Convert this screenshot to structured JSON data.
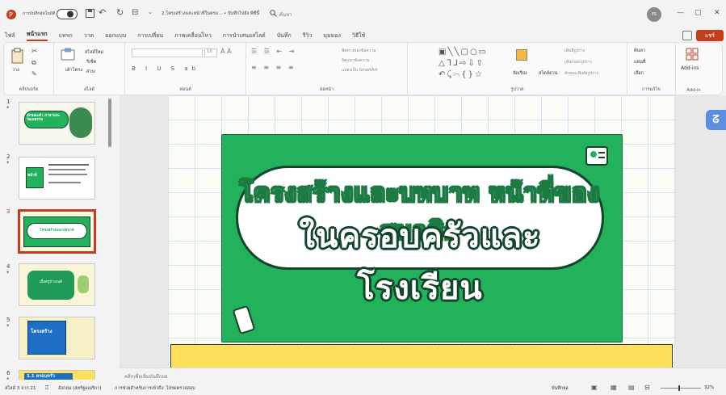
{
  "titlebar": {
    "autosave_label": "การบันทึกอัตโนมัติ",
    "doc_title": "2.โครงสร้างและหน้าที่ในครอ... • บันทึกไปยัง พีซีนี้",
    "search_placeholder": "ค้นหา",
    "user_initials": "PS",
    "minimize": "—",
    "restore": "▢",
    "close": "✕"
  },
  "ribbon_tabs": [
    "ไฟล์",
    "หน้าแรก",
    "แทรก",
    "วาด",
    "ออกแบบ",
    "การเปลี่ยน",
    "ภาพเคลื่อนไหว",
    "การนำเสนอสไลด์",
    "บันทึก",
    "รีวิว",
    "มุมมอง",
    "วิธีใช้"
  ],
  "ribbon_actions": {
    "share": "แชร์"
  },
  "ribbon": {
    "paste": "วาง",
    "clipboard_label": "คลิปบอร์ด",
    "new_slide": "สไลด์ใหม่",
    "layout": "เค้าโครง",
    "reset": "รีเซ็ต",
    "section": "ส่วน",
    "slides_label": "สไลด์",
    "font_size": "18",
    "font_label": "ฟอนต์",
    "text_direction": "ทิศทางของข้อความ",
    "align_text": "จัดแนวข้อความ",
    "smartart": "แปลงเป็น SmartArt",
    "paragraph_label": "ย่อหน้า",
    "drawing_label": "รูปวาด",
    "arrange": "จัดเรียง",
    "quick_styles": "สไตล์ด่วน",
    "shape_fill": "เติมสีรูปร่าง",
    "shape_outline": "เส้นกรอบรูปร่าง",
    "shape_effects": "ลักษณะพิเศษรูปร่าง",
    "find": "ค้นหา",
    "replace": "แทนที่",
    "select": "เลือก",
    "editing_label": "การแก้ไข",
    "addins": "Add-ins",
    "addins_label": "Add-in"
  },
  "thumbnails": [
    {
      "num": "1",
      "star": "*",
      "title": "ลักษณะคำ ภาษาและวัฒนธรรม"
    },
    {
      "num": "2",
      "star": "*",
      "title": "หน้าที่"
    },
    {
      "num": "3",
      "star": "",
      "title": "โครงสร้างและบทบาท"
    },
    {
      "num": "4",
      "star": "*",
      "title": "เมื่อครูถ้าเมนต์"
    },
    {
      "num": "5",
      "star": "*",
      "title": "โครงสร้าง"
    },
    {
      "num": "6",
      "star": "*",
      "title": "1.1 ครอบครัว"
    }
  ],
  "slide": {
    "line1": "โครงสร้างและบทบาท หน้าที่ของสมาชิก",
    "line2": "ในครอบครัวและโรงเรียน"
  },
  "notes_placeholder": "คลิกเพื่อเพิ่มบันทึกย่อ",
  "status": {
    "slide_count": "สไลด์ 3 จาก 21",
    "language": "อังกฤษ (สหรัฐอเมริกา)",
    "accessibility": "การช่วยสำหรับการเข้าถึง: โปรดตรวจสอบ",
    "notes": "บันทึกย่อ",
    "zoom": "32%"
  },
  "colors": {
    "accent": "#c43e1c",
    "slide_green": "#21b25b",
    "yellow": "#fde15a"
  }
}
